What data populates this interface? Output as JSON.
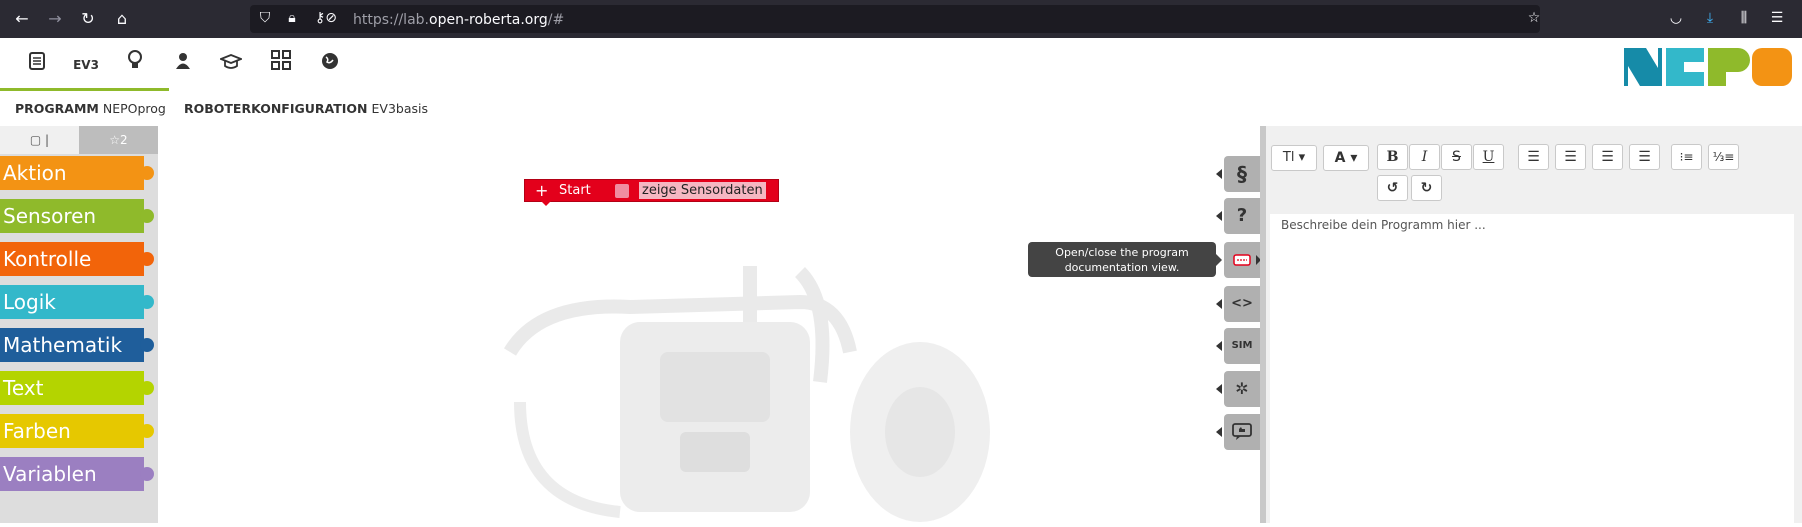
{
  "browser": {
    "url_prefix": "https://lab.",
    "url_domain": "open-roberta.org",
    "url_suffix": "/#"
  },
  "header": {
    "icons": [
      "document-icon",
      "ev3-icon",
      "lightbulb-icon",
      "user-icon",
      "graduation-cap-icon",
      "grid-icon",
      "globe-icon"
    ],
    "ev3_label": "EV3",
    "tabs": {
      "program_label": "PROGRAMM",
      "program_name": "NEPOprog",
      "config_label": "ROBOTERKONFIGURATION",
      "config_name": "EV3basis"
    },
    "logo_colors": [
      "#168ba8",
      "#33b8ca",
      "#8fba2b",
      "#f39314"
    ]
  },
  "toolbox": {
    "tab1": "▢ |",
    "tab2": "☆2",
    "categories": [
      {
        "label": "Aktion",
        "color": "#f39314"
      },
      {
        "label": "Sensoren",
        "color": "#8fba2b"
      },
      {
        "label": "Kontrolle",
        "color": "#f2640a"
      },
      {
        "label": "Logik",
        "color": "#33b8ca"
      },
      {
        "label": "Mathematik",
        "color": "#1f5e9b"
      },
      {
        "label": "Text",
        "color": "#b4d400"
      },
      {
        "label": "Farben",
        "color": "#e6c800"
      },
      {
        "label": "Variablen",
        "color": "#9b7fc1"
      }
    ]
  },
  "workspace": {
    "start_block_label": "Start",
    "start_block_option": "zeige Sensordaten",
    "start_block_color": "#e3001b"
  },
  "sidebuttons": {
    "items": [
      "§",
      "?",
      "doc",
      "<>",
      "SIM",
      "bug",
      "chat"
    ],
    "sim_label": "SIM",
    "tooltip": "Open/close the program documentation view."
  },
  "editor": {
    "placeholder": "Beschreibe dein Programm hier ...",
    "font_button": "Tl",
    "color_button": "A"
  }
}
